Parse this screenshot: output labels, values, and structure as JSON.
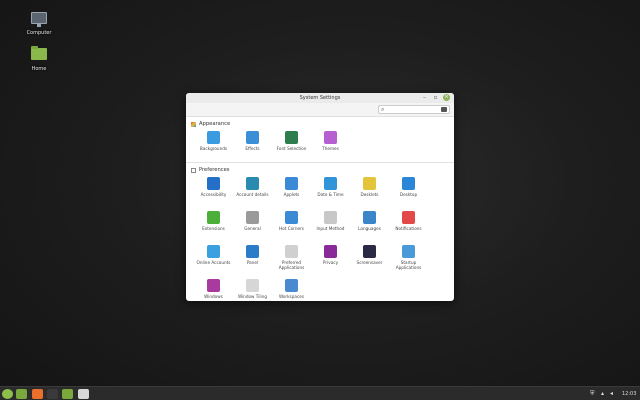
{
  "desktop": {
    "icons": [
      {
        "label": "Computer",
        "icon": "computer-icon"
      },
      {
        "label": "Home",
        "icon": "home-folder-icon"
      }
    ]
  },
  "window": {
    "title": "System Settings",
    "search_placeholder": "",
    "sections": [
      {
        "title": "Appearance",
        "items": [
          {
            "label": "Backgrounds",
            "icon": "backgrounds-icon",
            "color": "#3a9be0"
          },
          {
            "label": "Effects",
            "icon": "effects-icon",
            "color": "#3b8fd6"
          },
          {
            "label": "Font Selection",
            "icon": "font-icon",
            "color": "#2e7d4f"
          },
          {
            "label": "Themes",
            "icon": "themes-icon",
            "color": "#b65fd0"
          }
        ]
      },
      {
        "title": "Preferences",
        "items": [
          {
            "label": "Accessibility",
            "icon": "accessibility-icon",
            "color": "#2470c8"
          },
          {
            "label": "Account details",
            "icon": "account-icon",
            "color": "#2a8bb0"
          },
          {
            "label": "Applets",
            "icon": "applets-icon",
            "color": "#3a8ad8"
          },
          {
            "label": "Date & Time",
            "icon": "clock-icon",
            "color": "#3294d8"
          },
          {
            "label": "Desklets",
            "icon": "desklets-icon",
            "color": "#e4c43a"
          },
          {
            "label": "Desktop",
            "icon": "desktop-icon",
            "color": "#2a86d6"
          },
          {
            "label": "Extensions",
            "icon": "extensions-icon",
            "color": "#4caf3a"
          },
          {
            "label": "General",
            "icon": "general-icon",
            "color": "#9a9a9a"
          },
          {
            "label": "Hot Corners",
            "icon": "hot-corners-icon",
            "color": "#3b8ad6"
          },
          {
            "label": "Input Method",
            "icon": "input-method-icon",
            "color": "#c8c8c8"
          },
          {
            "label": "Languages",
            "icon": "languages-icon",
            "color": "#3a86c8"
          },
          {
            "label": "Notifications",
            "icon": "notifications-icon",
            "color": "#e24a4a"
          },
          {
            "label": "Online Accounts",
            "icon": "cloud-icon",
            "color": "#3aa0e0"
          },
          {
            "label": "Panel",
            "icon": "panel-icon",
            "color": "#2a7cc8"
          },
          {
            "label": "Preferred Applications",
            "icon": "preferred-apps-icon",
            "color": "#d0d0d0"
          },
          {
            "label": "Privacy",
            "icon": "privacy-icon",
            "color": "#8a2a9a"
          },
          {
            "label": "Screensaver",
            "icon": "screensaver-icon",
            "color": "#2a2a44"
          },
          {
            "label": "Startup Applications",
            "icon": "startup-icon",
            "color": "#4a9ad8"
          },
          {
            "label": "Windows",
            "icon": "windows-icon",
            "color": "#a83aa0"
          },
          {
            "label": "Window Tiling",
            "icon": "window-tiling-icon",
            "color": "#d6d6d6"
          },
          {
            "label": "Workspaces",
            "icon": "workspaces-icon",
            "color": "#4a8ad0"
          }
        ]
      }
    ]
  },
  "panel": {
    "clock": "12:03",
    "launchers": [
      {
        "icon": "menu-icon",
        "color": "#8cc04a"
      },
      {
        "icon": "files-icon",
        "color": "#7aa83c"
      },
      {
        "icon": "firefox-icon",
        "color": "#e8702a"
      },
      {
        "icon": "terminal-icon",
        "color": "#3a3a3a"
      },
      {
        "icon": "folder-icon",
        "color": "#7aa83c"
      },
      {
        "icon": "settings-window-icon",
        "color": "#d8d8d8"
      }
    ]
  }
}
